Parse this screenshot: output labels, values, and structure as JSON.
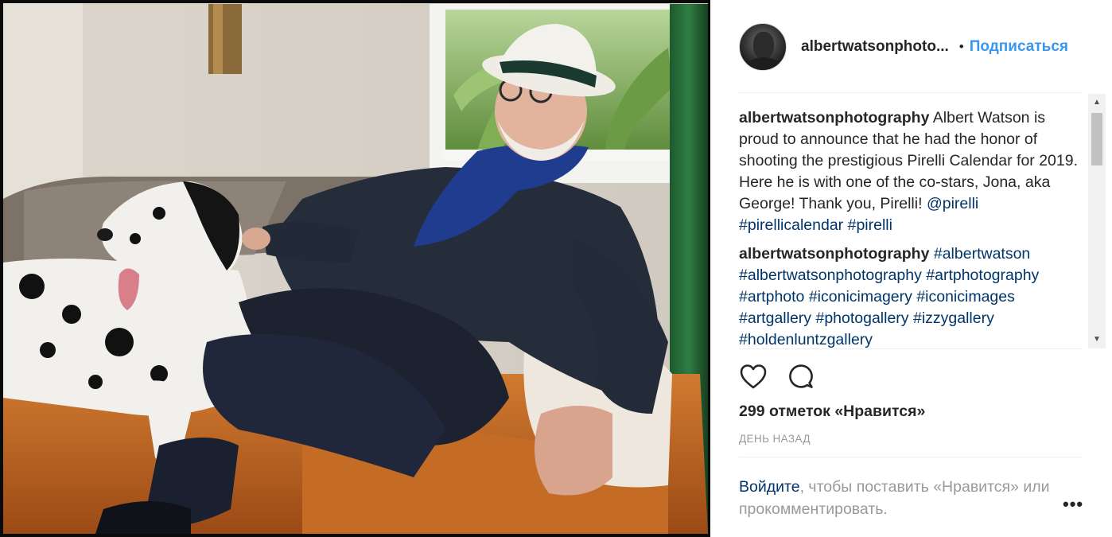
{
  "post": {
    "author": {
      "username": "albertwatsonphotography",
      "username_truncated": "albertwatsonphoto..."
    },
    "follow_separator": "•",
    "follow_label": "Подписаться",
    "photo_alt_icon": "photo",
    "comments": [
      {
        "username": "albertwatsonphotography",
        "text": " Albert Watson is proud to announce that he had the honor of shooting the prestigious Pirelli Calendar for 2019. Here he is with one of the co-stars, Jona, aka George! Thank you, Pirelli! ",
        "tags": [
          "@pirelli",
          "#pirellicalendar",
          "#pirelli"
        ]
      },
      {
        "username": "albertwatsonphotography",
        "text": " ",
        "tags": [
          "#albertwatson",
          "#albertwatsonphotography",
          "#artphotography",
          "#artphoto",
          "#iconicimagery",
          "#iconicimages",
          "#artgallery",
          "#photogallery",
          "#izzygallery",
          "#holdenluntzgallery"
        ]
      }
    ],
    "actions": {
      "like_icon": "heart-icon",
      "comment_icon": "comment-icon"
    },
    "likes_text": "299 отметок «Нравится»",
    "timestamp": "ДЕНЬ НАЗАД",
    "login_link": "Войдите",
    "login_rest": ", чтобы поставить «Нравится» или прокомментировать.",
    "more_label": "•••"
  },
  "colors": {
    "link": "#003569",
    "follow": "#3897f0",
    "text": "#262626",
    "muted": "#999999",
    "separator": "#efefef"
  }
}
